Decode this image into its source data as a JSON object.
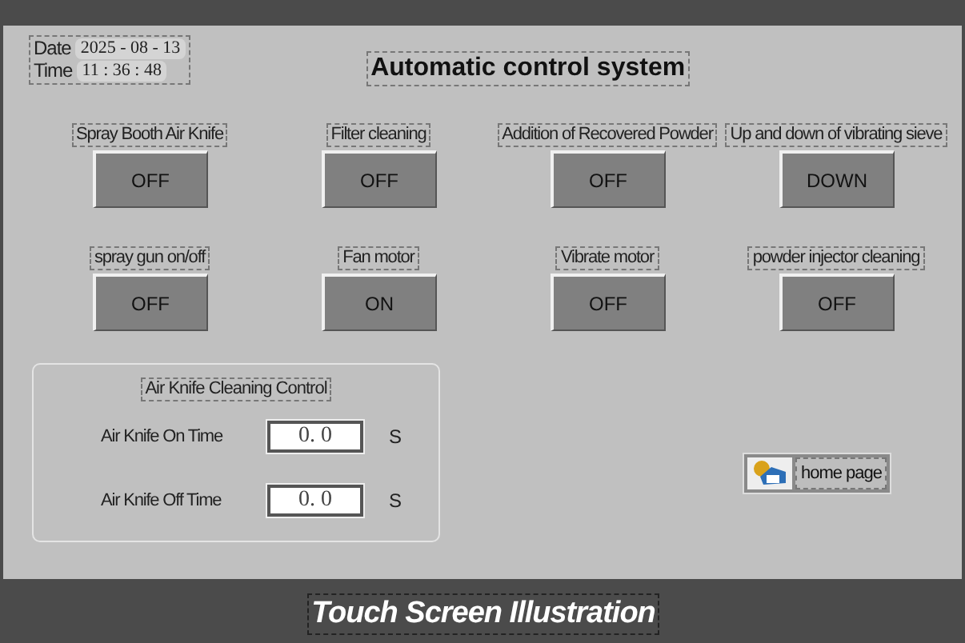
{
  "clock": {
    "date_label": "Date",
    "date": "2025 - 08 - 13",
    "time_label": "Time",
    "time": "11 : 36 : 48"
  },
  "title": "Automatic control system",
  "controls": [
    {
      "label": "Spray Booth Air Knife",
      "value": "OFF"
    },
    {
      "label": "Filter cleaning",
      "value": "OFF"
    },
    {
      "label": "Addition of Recovered Powder",
      "value": "OFF"
    },
    {
      "label": "Up and down of vibrating sieve",
      "value": "DOWN"
    },
    {
      "label": "spray gun on/off",
      "value": "OFF"
    },
    {
      "label": "Fan motor",
      "value": "ON"
    },
    {
      "label": "Vibrate motor",
      "value": "OFF"
    },
    {
      "label": "powder injector cleaning",
      "value": "OFF"
    }
  ],
  "cleaning_panel": {
    "title": "Air Knife Cleaning Control",
    "fields": [
      {
        "label": "Air Knife On Time",
        "value": "0. 0",
        "unit": "S"
      },
      {
        "label": "Air Knife Off Time",
        "value": "0. 0",
        "unit": "S"
      }
    ]
  },
  "home_button": {
    "label": "home page"
  },
  "caption": "Touch Screen Illustration"
}
